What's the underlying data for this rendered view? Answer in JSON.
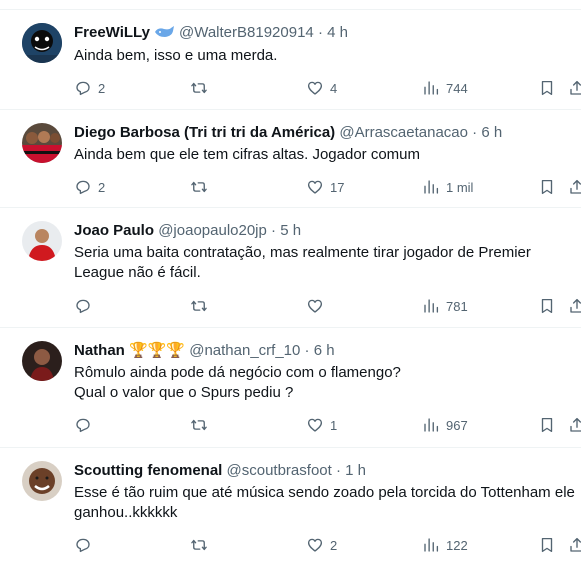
{
  "tweets": [
    {
      "name": "FreeWiLLy",
      "handle": "@WalterB81920914",
      "sep": "·",
      "time": "4 h",
      "lines": [
        "Ainda bem, isso e uma merda."
      ],
      "replies": "2",
      "retweets": "",
      "likes": "4",
      "views": "744"
    },
    {
      "name": "Diego Barbosa (Tri tri tri da América)",
      "handle": "@Arrascaetanacao",
      "sep": "·",
      "time": "6 h",
      "lines": [
        "Ainda bem que ele tem cifras altas. Jogador comum"
      ],
      "replies": "2",
      "retweets": "",
      "likes": "17",
      "views": "1 mil"
    },
    {
      "name": "Joao Paulo",
      "handle": "@joaopaulo20jp",
      "sep": "·",
      "time": "5 h",
      "lines": [
        "Seria uma baita contratação, mas realmente tirar jogador de Premier",
        "League não é fácil."
      ],
      "replies": "",
      "retweets": "",
      "likes": "",
      "views": "781"
    },
    {
      "name": "Nathan",
      "name_emoji": "🏆🏆🏆",
      "handle": "@nathan_crf_10",
      "sep": "·",
      "time": "6 h",
      "lines": [
        "Rômulo ainda pode dá negócio com o flamengo?",
        "Qual o valor que o Spurs pediu ?"
      ],
      "replies": "",
      "retweets": "",
      "likes": "1",
      "views": "967"
    },
    {
      "name": "Scoutting fenomenal",
      "handle": "@scoutbrasfoot",
      "sep": "·",
      "time": "1 h",
      "lines": [
        "Esse é tão ruim que até música sendo zoado pela torcida do Tottenham ele",
        "ganhou..kkkkkk"
      ],
      "replies": "",
      "retweets": "",
      "likes": "2",
      "views": "122"
    }
  ],
  "icons": {
    "reply": "reply-icon",
    "retweet": "retweet-icon",
    "like": "heart-icon",
    "views": "views-icon",
    "bookmark": "bookmark-icon",
    "share": "share-icon",
    "badge": "whale-badge-icon"
  },
  "colors": {
    "text": "#0f1419",
    "muted": "#536471",
    "divider": "#eff3f4",
    "badge": "#1d9bf0"
  }
}
